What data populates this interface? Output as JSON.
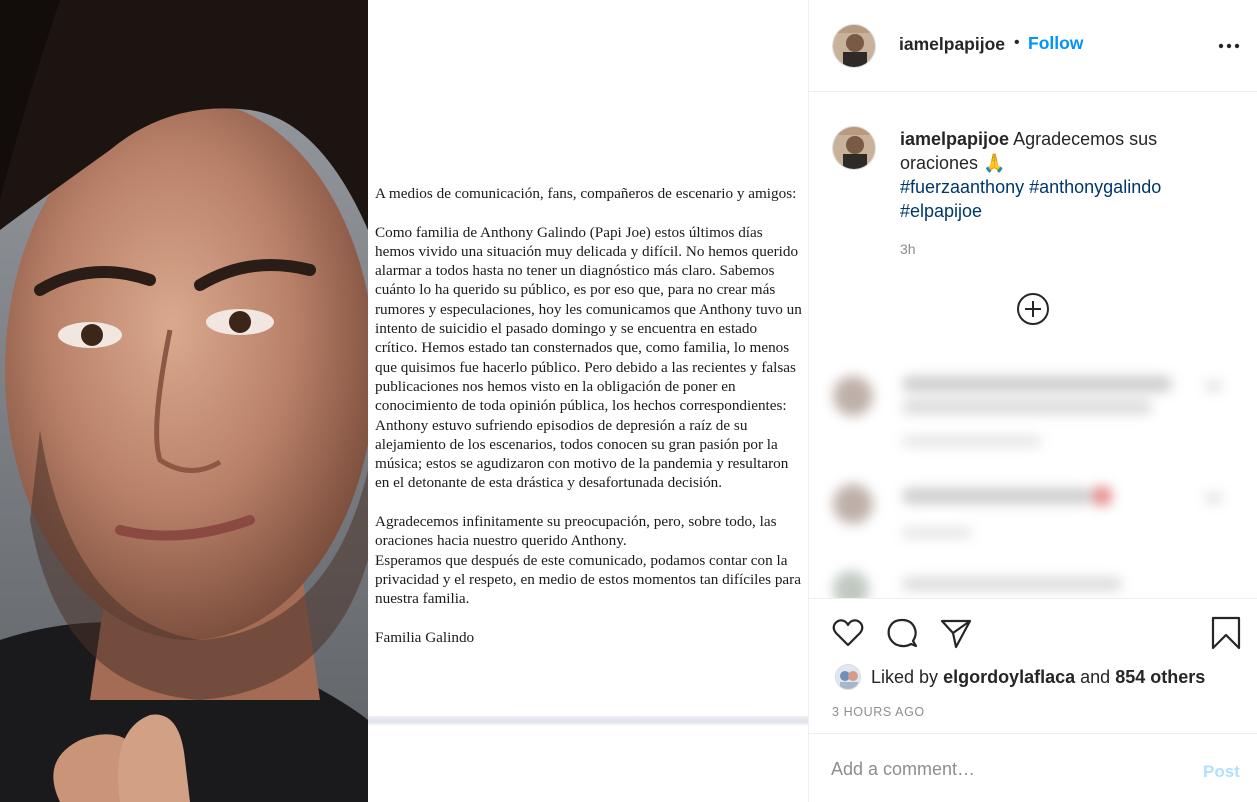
{
  "post": {
    "username": "iamelpapijoe",
    "separator": "•",
    "follow_label": "Follow",
    "caption": {
      "username": "iamelpapijoe",
      "text": "Agradecemos sus oraciones",
      "emoji": "🙏",
      "hashtags": [
        "#fuerzaanthony",
        "#anthonygalindo",
        "#elpapijoe"
      ],
      "time": "3h"
    },
    "likes": {
      "prefix": "Liked by",
      "user": "elgordoylaflaca",
      "joiner": "and",
      "others": "854 others"
    },
    "timestamp": "3 HOURS AGO",
    "comment_placeholder": "Add a comment…",
    "post_label": "Post"
  },
  "media": {
    "letter": {
      "p1": "A medios de comunicación, fans, compañeros de escenario y amigos:",
      "p2": "Como familia de Anthony Galindo (Papi Joe) estos últimos días hemos vivido una situación muy delicada y difícil. No hemos querido alarmar a todos hasta no tener un diagnóstico más claro. Sabemos cuánto lo ha querido su público, es por eso que, para no crear más rumores y especulaciones, hoy les comunicamos que Anthony tuvo un intento de suicidio el pasado domingo y se encuentra en estado crítico. Hemos estado tan consternados que, como familia, lo menos que quisimos fue hacerlo público. Pero debido a las recientes y falsas publicaciones nos hemos visto en la obligación de poner en conocimiento de toda opinión pública, los hechos correspondientes: Anthony estuvo sufriendo episodios de depresión a raíz de su alejamiento de los escenarios, todos conocen su gran pasión por la música; estos se agudizaron con motivo de la pandemia y resultaron en el detonante de esta drástica y desafortunada decisión.",
      "p3": "Agradecemos infinitamente su preocupación, pero, sobre todo, las oraciones hacia nuestro querido Anthony.",
      "p4": "Esperamos que después de este comunicado, podamos contar con la privacidad y el respeto, en medio de estos momentos tan difíciles para nuestra familia.",
      "signature": "Familia Galindo"
    }
  },
  "colors": {
    "follow": "#0095f6",
    "hashtag": "#00376b",
    "post_disabled": "#b2dffc",
    "muted": "#8e8e8e",
    "border": "#efefef"
  },
  "icons": [
    "more-options-icon",
    "add-circle-icon",
    "heart-icon",
    "comment-icon",
    "share-icon",
    "bookmark-icon"
  ]
}
